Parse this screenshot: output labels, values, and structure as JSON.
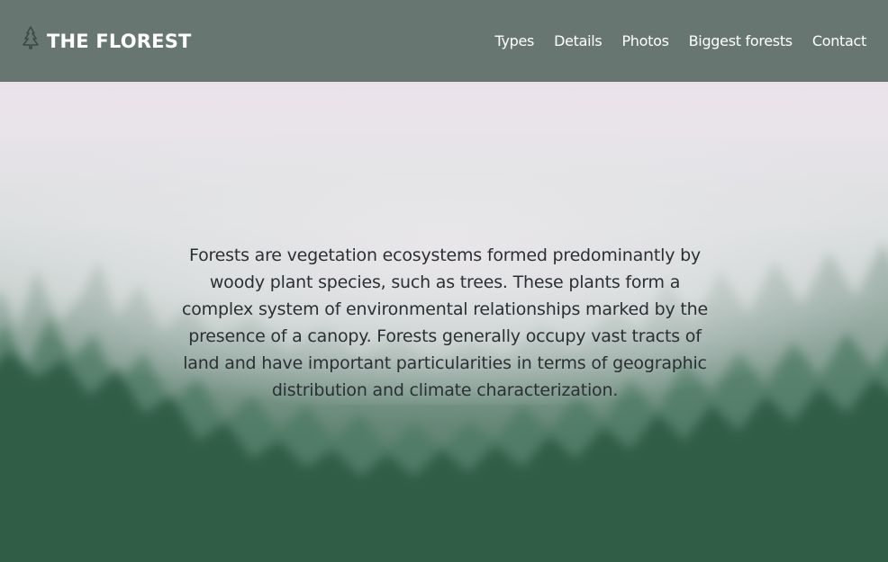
{
  "header": {
    "brand_name": "THE FLOREST",
    "brand_icon": "pine-tree-icon",
    "nav": [
      {
        "label": "Types"
      },
      {
        "label": "Details"
      },
      {
        "label": "Photos"
      },
      {
        "label": "Biggest forests"
      },
      {
        "label": "Contact"
      }
    ]
  },
  "hero": {
    "text": "Forests are vegetation ecosystems formed predominantly by woody plant species, such as trees. These plants form a complex system of environmental relationships marked by the presence of a canopy. Forests generally occupy vast tracts of land and have important particularities in terms of geographic distribution and climate characterization."
  },
  "colors": {
    "header_bg": "#677670",
    "text_dark": "#2b2f33",
    "white": "#ffffff"
  }
}
